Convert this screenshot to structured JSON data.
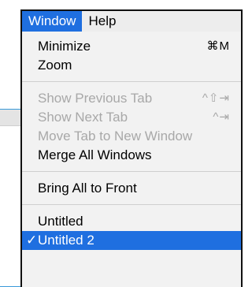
{
  "menubar": {
    "items": [
      {
        "label": "Window",
        "active": true
      },
      {
        "label": "Help",
        "active": false
      }
    ]
  },
  "window_menu": {
    "group1": [
      {
        "label": "Minimize",
        "shortcut": "⌘M",
        "enabled": true
      },
      {
        "label": "Zoom",
        "shortcut": "",
        "enabled": true
      }
    ],
    "group2": [
      {
        "label": "Show Previous Tab",
        "shortcut": "^⇧⇥",
        "enabled": false
      },
      {
        "label": "Show Next Tab",
        "shortcut": "^⇥",
        "enabled": false
      },
      {
        "label": "Move Tab to New Window",
        "shortcut": "",
        "enabled": false
      },
      {
        "label": "Merge All Windows",
        "shortcut": "",
        "enabled": true
      }
    ],
    "group3": [
      {
        "label": "Bring All to Front",
        "shortcut": "",
        "enabled": true
      }
    ],
    "group4": [
      {
        "label": "Untitled",
        "checked": false,
        "highlighted": false
      },
      {
        "label": "Untitled 2",
        "checked": true,
        "highlighted": true
      }
    ],
    "checkmark_glyph": "✓"
  },
  "colors": {
    "accent": "#1f6fe0",
    "menu_bg": "#f2f2f2",
    "disabled_text": "#a8a8a8",
    "separator": "#cfcfcf"
  }
}
